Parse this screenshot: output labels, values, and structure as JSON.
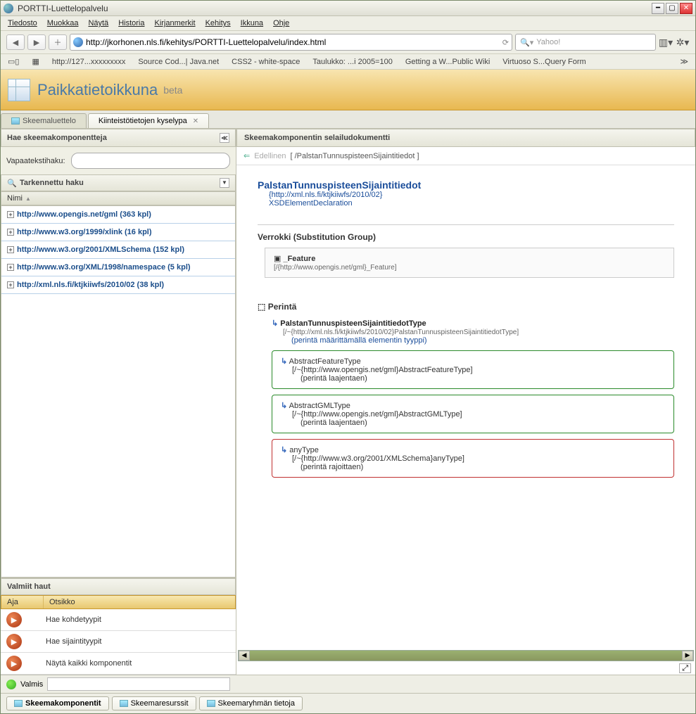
{
  "window": {
    "title": "PORTTI-Luettelopalvelu"
  },
  "menubar": [
    "Tiedosto",
    "Muokkaa",
    "Näytä",
    "Historia",
    "Kirjanmerkit",
    "Kehitys",
    "Ikkuna",
    "Ohje"
  ],
  "url": "http://jkorhonen.nls.fi/kehitys/PORTTI-Luettelopalvelu/index.html",
  "search_placeholder": "Yahoo!",
  "bookmarks": [
    "http://127...xxxxxxxxx",
    "Source Cod...| Java.net",
    "CSS2 - white-space",
    "Taulukko: ...i 2005=100",
    "Getting a W...Public Wiki",
    "Virtuoso S...Query Form"
  ],
  "app": {
    "title": "Paikkatietoikkuna",
    "beta": "beta"
  },
  "tabs": [
    {
      "label": "Skeemaluettelo",
      "active": false
    },
    {
      "label": "Kiinteistötietojen kyselypa",
      "active": true
    }
  ],
  "left": {
    "search_header": "Hae skeemakomponentteja",
    "freetext_label": "Vapaatekstihaku:",
    "adv_header": "Tarkennettu haku",
    "col_header": "Nimi",
    "tree": [
      "http://www.opengis.net/gml (363 kpl)",
      "http://www.w3.org/1999/xlink (16 kpl)",
      "http://www.w3.org/2001/XMLSchema (152 kpl)",
      "http://www.w3.org/XML/1998/namespace (5 kpl)",
      "http://xml.nls.fi/ktjkiiwfs/2010/02 (38 kpl)"
    ],
    "valmiit_header": "Valmiit haut",
    "valmiit_cols": {
      "c1": "Aja",
      "c2": "Otsikko"
    },
    "valmiit_rows": [
      "Hae kohdetyypit",
      "Hae sijaintityypit",
      "Näytä kaikki komponentit"
    ]
  },
  "right": {
    "header": "Skeemakomponentin selailudokumentti",
    "prev": "Edellinen",
    "breadcrumb": "[ /PalstanTunnuspisteenSijaintitiedot ]",
    "title": "PalstanTunnuspisteenSijaintitiedot",
    "ns": "{http://xml.nls.fi/ktjkiiwfs/2010/02}",
    "decl": "XSDElementDeclaration",
    "verrokki_label": "Verrokki (Substitution Group)",
    "feature": {
      "name": "_Feature",
      "path": "[/{http://www.opengis.net/gml}_Feature]"
    },
    "perinta_label": "Perintä",
    "inh": [
      {
        "name": "PalstanTunnuspisteenSijaintitiedotType",
        "path": "[/~{http://xml.nls.fi/ktjkiiwfs/2010/02}PalstanTunnuspisteenSijaintitiedotType]",
        "note": "(perintä määrittämällä elementin tyyppi)",
        "box": "none"
      },
      {
        "name": "AbstractFeatureType",
        "path": "[/~{http://www.opengis.net/gml}AbstractFeatureType]",
        "note": "(perintä laajentaen)",
        "box": "green"
      },
      {
        "name": "AbstractGMLType",
        "path": "[/~{http://www.opengis.net/gml}AbstractGMLType]",
        "note": "(perintä laajentaen)",
        "box": "green"
      },
      {
        "name": "anyType",
        "path": "[/~{http://www.w3.org/2001/XMLSchema}anyType]",
        "note": "(perintä rajoittaen)",
        "box": "red"
      }
    ]
  },
  "status": {
    "label": "Valmis"
  },
  "bottom_tabs": [
    "Skeemakomponentit",
    "Skeemaresurssit",
    "Skeemaryhmän tietoja"
  ]
}
